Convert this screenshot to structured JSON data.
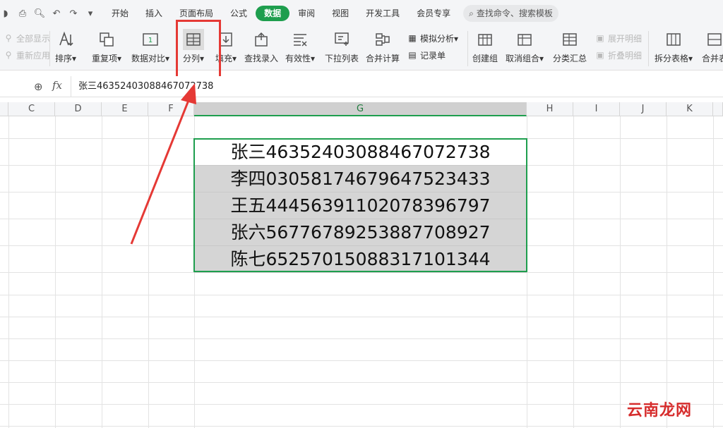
{
  "menubar": {
    "tabs": [
      "开始",
      "插入",
      "页面布局",
      "公式",
      "数据",
      "审阅",
      "视图",
      "开发工具",
      "会员专享"
    ],
    "active_tab": "数据",
    "search_placeholder": "查找命令、搜索模板"
  },
  "ribbon": {
    "show_all": "全部显示",
    "reapply": "重新应用",
    "sort": "排序",
    "duplicates": "重复项",
    "compare": "数据对比",
    "split_columns": "分列",
    "fill": "填充",
    "find_input": "查找录入",
    "validity": "有效性",
    "dropdown_list": "下拉列表",
    "consolidate": "合并计算",
    "simulate": "模拟分析",
    "record_sheet": "记录单",
    "create_group": "创建组",
    "ungroup": "取消组合",
    "subtotal": "分类汇总",
    "expand_detail": "展开明细",
    "collapse_detail": "折叠明细",
    "split_table": "拆分表格",
    "merge_table": "合并表"
  },
  "formula_bar": {
    "fx_label": "fx",
    "value": "张三4635240308846707​2738"
  },
  "columns": [
    "C",
    "D",
    "E",
    "F",
    "G",
    "H",
    "I",
    "J",
    "K"
  ],
  "selected_column": "G",
  "cells": [
    "张三4635240308846707​2738",
    "李四0305817467964752​3433",
    "王五4445639110207839​6797",
    "张六5677678925388770​8927",
    "陈七6525701508831710​1344"
  ],
  "watermark": "云南龙网",
  "colors": {
    "active_tab": "#1e9e4e",
    "highlight": "#e53935",
    "selection_border": "#1e9e4e"
  }
}
